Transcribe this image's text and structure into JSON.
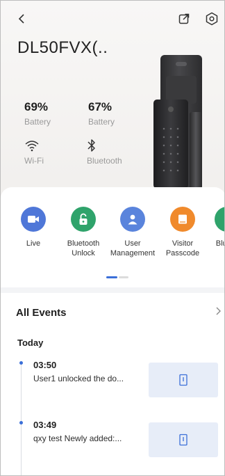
{
  "header": {
    "device_name": "DL50FVX(.."
  },
  "stats": [
    {
      "value": "69%",
      "label": "Battery"
    },
    {
      "value": "67%",
      "label": "Battery"
    }
  ],
  "connectivity": [
    {
      "label": "Wi-Fi",
      "icon": "wifi-icon"
    },
    {
      "label": "Bluetooth",
      "icon": "bluetooth-icon"
    }
  ],
  "actions": [
    {
      "label": "Live",
      "color": "#4f77d8",
      "icon": "video-camera-icon"
    },
    {
      "label": "Bluetooth Unlock",
      "color": "#2fa36b",
      "icon": "unlock-icon"
    },
    {
      "label": "User Management",
      "color": "#5a84dc",
      "icon": "user-icon"
    },
    {
      "label": "Visitor Passcode",
      "color": "#f08a2c",
      "icon": "passcode-card-icon"
    },
    {
      "label": "Blue K",
      "color": "#2fa36b",
      "icon": "bluetooth-key-icon"
    }
  ],
  "events": {
    "title": "All Events",
    "group": "Today",
    "items": [
      {
        "time": "03:50",
        "desc": "User1 unlocked the do..."
      },
      {
        "time": "03:49",
        "desc": "qxy test Newly added:..."
      }
    ]
  },
  "colors": {
    "accent": "#3b6fd8",
    "thumb_bg": "#e7edf8"
  }
}
